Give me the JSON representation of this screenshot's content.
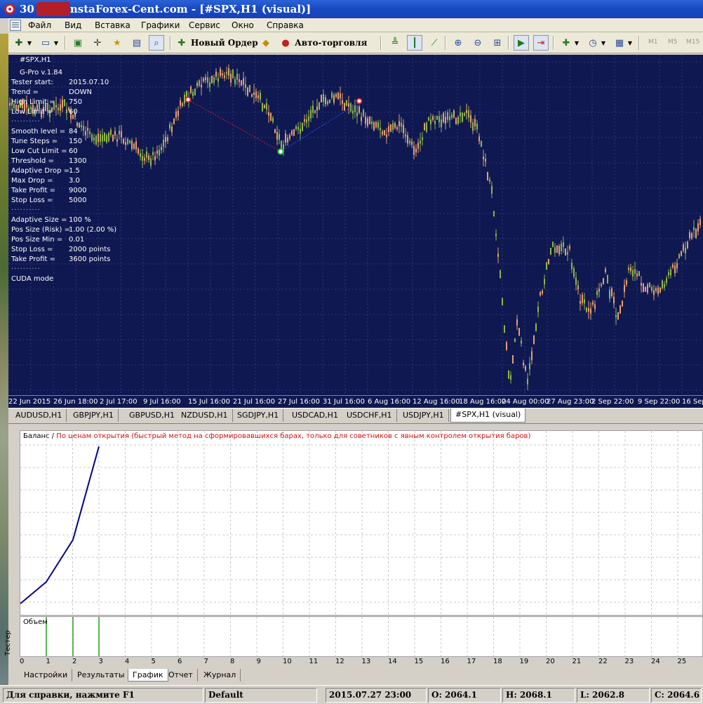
{
  "window": {
    "title": "InstaForex-Cent.com - [#SPX,H1 (visual)]",
    "title_prefix": "30"
  },
  "menu": [
    "Файл",
    "Вид",
    "Вставка",
    "Графики",
    "Сервис",
    "Окно",
    "Справка"
  ],
  "toolbar": {
    "new_order": "Новый Ордер",
    "auto_trading": "Авто-торговля",
    "timeframes": [
      "M1",
      "M5",
      "M15"
    ]
  },
  "chart": {
    "symbol": "#SPX,H1",
    "background": "#0f1850",
    "candle_up": "#8fb84a",
    "candle_down": "#e8a070",
    "info": [
      {
        "label": "G-Pro v.1.84",
        "value": ""
      },
      {
        "label": "Tester start:",
        "value": "2015.07.10"
      },
      {
        "label": "Trend =",
        "value": "DOWN"
      },
      {
        "label": "High Limit =",
        "value": "750"
      },
      {
        "label": "Low Limit =",
        "value": "60"
      },
      {
        "label": "Smooth level =",
        "value": "84"
      },
      {
        "label": "Tune Steps =",
        "value": "150"
      },
      {
        "label": "Low Cut Limit =",
        "value": "60"
      },
      {
        "label": "Threshold =",
        "value": "1300"
      },
      {
        "label": "Adaptive Drop =",
        "value": "1.5"
      },
      {
        "label": "Max Drop =",
        "value": "3.0"
      },
      {
        "label": "Take Profit =",
        "value": "9000"
      },
      {
        "label": "Stop Loss =",
        "value": "5000"
      },
      {
        "label": "Adaptive Size =",
        "value": "100 %"
      },
      {
        "label": "Pos Size (Risk) =",
        "value": "1.00  (2.00 %)"
      },
      {
        "label": "Pos Size Min =",
        "value": "0.01"
      },
      {
        "label": "Stop Loss =",
        "value": "2000 points"
      },
      {
        "label": "Take Profit =",
        "value": "3600 points"
      },
      {
        "label": "CUDA mode",
        "value": ""
      }
    ],
    "x_labels": [
      "22 Jun 2015",
      "26 Jun 18:00",
      "2 Jul 17:00",
      "9 Jul 16:00",
      "15 Jul 16:00",
      "21 Jul 16:00",
      "27 Jul 16:00",
      "31 Jul 16:00",
      "6 Aug 16:00",
      "12 Aug 16:00",
      "18 Aug 16:00",
      "24 Aug 00:00",
      "27 Aug 23:00",
      "2 Sep 22:00",
      "9 Sep 22:00",
      "16 Sep"
    ]
  },
  "symbol_tabs": [
    "AUDUSD,H1",
    "GBPJPY,H1",
    "GBPUSD,H1",
    "NZDUSD,H1",
    "SGDJPY,H1",
    "USDCAD,H1",
    "USDCHF,H1",
    "USDJPY,H1",
    "#SPX,H1 (visual)"
  ],
  "tester": {
    "vertical_label": "Тестер",
    "balance_label": "Баланс",
    "separator": "/",
    "mode_text": "По ценам открытия (быстрый метод на сформировавшихся барах, только для советников с явным контролем открытия баров)",
    "volume_label": "Объем",
    "x_ticks": [
      "0",
      "1",
      "2",
      "3",
      "4",
      "5",
      "6",
      "7",
      "8",
      "9",
      "10",
      "11",
      "12",
      "13",
      "14",
      "15",
      "16",
      "17",
      "18",
      "19",
      "20",
      "21",
      "22",
      "23",
      "24",
      "25",
      "2"
    ],
    "tabs": [
      "Настройки",
      "Результаты",
      "График",
      "Отчет",
      "Журнал"
    ],
    "active_tab": "График",
    "balance_points": [
      0,
      1,
      2,
      3
    ],
    "balance_line_color": "#00008b",
    "volume_color": "#20a020"
  },
  "status": {
    "help": "Для справки, нажмите F1",
    "profile": "Default",
    "datetime": "2015.07.27 23:00",
    "open": "O: 2064.1",
    "high": "H: 2068.1",
    "low": "L: 2062.8",
    "close": "C: 2064.6"
  }
}
